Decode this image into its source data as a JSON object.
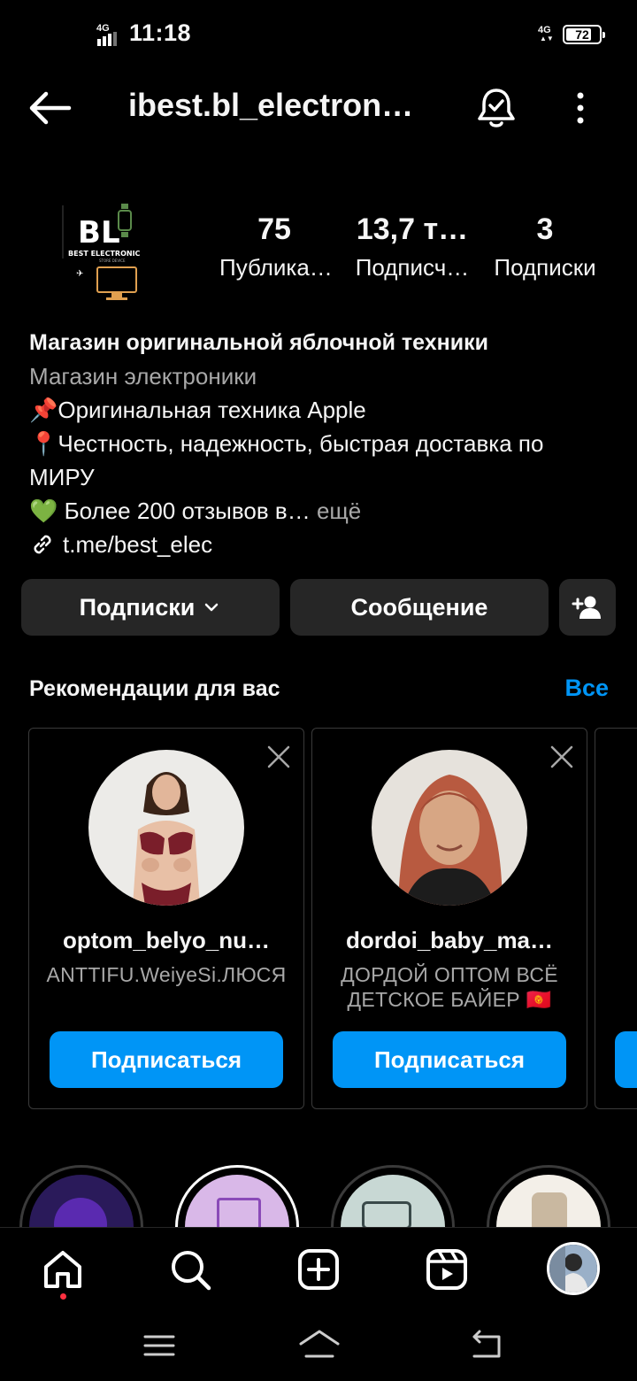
{
  "status_bar": {
    "time": "11:18",
    "network_left": "4G",
    "network_right": "4G",
    "battery": "72"
  },
  "header": {
    "username": "ibest.bl_electron…"
  },
  "profile": {
    "stats": [
      {
        "value": "75",
        "label": "Публика…"
      },
      {
        "value": "13,7 т…",
        "label": "Подписч…"
      },
      {
        "value": "3",
        "label": "Подписки"
      }
    ]
  },
  "bio": {
    "name": "Магазин оригинальной яблочной техники",
    "category": "Магазин электроники",
    "line1": "📌Оригинальная техника Apple",
    "line2": "📍Честность, надежность, быстрая доставка по МИРУ",
    "line3": "💚 Более 200 отзывов в…",
    "more": "ещё",
    "link": "t.me/best_elec"
  },
  "actions": {
    "following": "Подписки",
    "message": "Сообщение"
  },
  "recommendations": {
    "title": "Рекомендации для вас",
    "see_all": "Все",
    "cards": [
      {
        "username": "optom_belyo_nu…",
        "subtitle_line1": "ANTTIFU.WeiyeSi.ЛЮСЯ",
        "subtitle_line2": "",
        "button": "Подписаться"
      },
      {
        "username": "dordoi_baby_ma…",
        "subtitle_line1": "ДОРДОЙ ОПТОМ ВСЁ",
        "subtitle_line2": "ДЕТСКОЕ  БАЙЕР 🇰🇬",
        "button": "Подписаться"
      }
    ]
  },
  "colors": {
    "accent": "#0095f6",
    "background": "#000000",
    "button_bg": "#262626",
    "secondary_text": "#a8a8a8",
    "notification_dot": "#ff3040"
  },
  "icons": [
    "back-arrow-icon",
    "bell-check-icon",
    "more-vertical-icon",
    "add-user-icon",
    "chevron-down-icon",
    "link-icon",
    "close-icon",
    "home-icon",
    "search-icon",
    "create-icon",
    "reels-icon",
    "menu-icon",
    "home-outline-icon",
    "return-icon"
  ]
}
